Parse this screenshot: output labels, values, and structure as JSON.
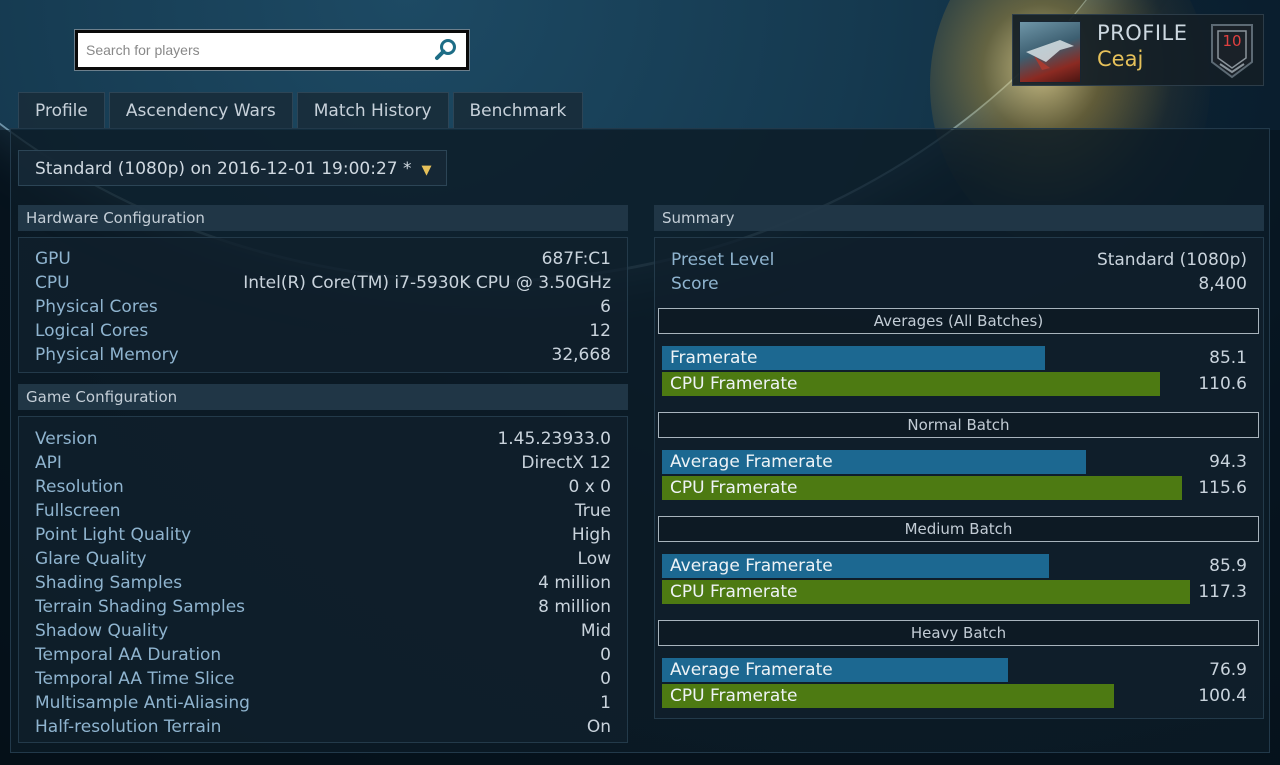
{
  "search": {
    "placeholder": "Search for players"
  },
  "profile": {
    "label": "PROFILE",
    "name": "Ceaj",
    "level": "10"
  },
  "tabs": [
    {
      "label": "Profile"
    },
    {
      "label": "Ascendency Wars"
    },
    {
      "label": "Match History"
    },
    {
      "label": "Benchmark"
    }
  ],
  "preset_select": {
    "value": "Standard (1080p) on 2016-12-01 19:00:27 *",
    "arrow": "▼"
  },
  "hardware": {
    "title": "Hardware Configuration",
    "rows": [
      {
        "key": "GPU",
        "value": "687F:C1"
      },
      {
        "key": "CPU",
        "value": "Intel(R) Core(TM) i7-5930K CPU @ 3.50GHz"
      },
      {
        "key": "Physical Cores",
        "value": "6"
      },
      {
        "key": "Logical Cores",
        "value": "12"
      },
      {
        "key": "Physical Memory",
        "value": "32,668"
      }
    ]
  },
  "game": {
    "title": "Game Configuration",
    "rows": [
      {
        "key": "Version",
        "value": "1.45.23933.0"
      },
      {
        "key": "API",
        "value": "DirectX 12"
      },
      {
        "key": "Resolution",
        "value": "0 x 0"
      },
      {
        "key": "Fullscreen",
        "value": "True"
      },
      {
        "key": "Point Light Quality",
        "value": "High"
      },
      {
        "key": "Glare Quality",
        "value": "Low"
      },
      {
        "key": "Shading Samples",
        "value": "4 million"
      },
      {
        "key": "Terrain Shading Samples",
        "value": "8 million"
      },
      {
        "key": "Shadow Quality",
        "value": "Mid"
      },
      {
        "key": "Temporal AA Duration",
        "value": "0"
      },
      {
        "key": "Temporal AA Time Slice",
        "value": "0"
      },
      {
        "key": "Multisample Anti-Aliasing",
        "value": "1"
      },
      {
        "key": "Half-resolution Terrain",
        "value": "On"
      }
    ]
  },
  "summary": {
    "title": "Summary",
    "rows": [
      {
        "key": "Preset Level",
        "value": "Standard (1080p)"
      },
      {
        "key": "Score",
        "value": "8,400"
      }
    ],
    "bar_scale_max": 120,
    "groups": [
      {
        "title": "Averages (All Batches)",
        "bars": [
          {
            "label": "Framerate",
            "value": "85.1",
            "color": "#1c6891"
          },
          {
            "label": "CPU Framerate",
            "value": "110.6",
            "color": "#4d7a12"
          }
        ]
      },
      {
        "title": "Normal Batch",
        "bars": [
          {
            "label": "Average Framerate",
            "value": "94.3",
            "color": "#1c6891"
          },
          {
            "label": "CPU Framerate",
            "value": "115.6",
            "color": "#4d7a12"
          }
        ]
      },
      {
        "title": "Medium Batch",
        "bars": [
          {
            "label": "Average Framerate",
            "value": "85.9",
            "color": "#1c6891"
          },
          {
            "label": "CPU Framerate",
            "value": "117.3",
            "color": "#4d7a12"
          }
        ]
      },
      {
        "title": "Heavy Batch",
        "bars": [
          {
            "label": "Average Framerate",
            "value": "76.9",
            "color": "#1c6891"
          },
          {
            "label": "CPU Framerate",
            "value": "100.4",
            "color": "#4d7a12"
          }
        ]
      }
    ]
  }
}
